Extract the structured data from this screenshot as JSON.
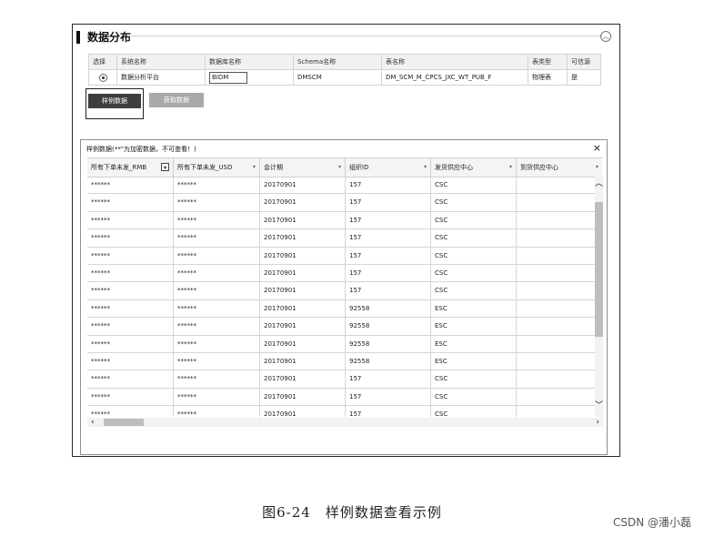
{
  "section": {
    "title": "数据分布"
  },
  "meta_table": {
    "headers": [
      "选择",
      "系统名称",
      "数据库名称",
      "Schema名称",
      "表名称",
      "表类型",
      "可信源"
    ],
    "row": {
      "system": "数据分析平台",
      "db_name": "BIDM",
      "schema": "DMSCM",
      "table": "DM_SCM_M_CPCS_JXC_WT_PUB_F",
      "table_type": "物理表",
      "trusted": "是"
    }
  },
  "buttons": {
    "sample": "样例数据",
    "fetch": "获取数据"
  },
  "dialog": {
    "title": "样例数据(**\"为加密数据，不可查看！)",
    "close": "×",
    "columns": [
      "所有下单未发_RMB",
      "所有下单未发_USD",
      "会计期",
      "组织ID",
      "发货供应中心",
      "到货供应中心"
    ],
    "rows": [
      [
        "******",
        "******",
        "20170901",
        "157",
        "CSC",
        ""
      ],
      [
        "******",
        "******",
        "20170901",
        "157",
        "CSC",
        ""
      ],
      [
        "******",
        "******",
        "20170901",
        "157",
        "CSC",
        ""
      ],
      [
        "******",
        "******",
        "20170901",
        "157",
        "CSC",
        ""
      ],
      [
        "******",
        "******",
        "20170901",
        "157",
        "CSC",
        ""
      ],
      [
        "******",
        "******",
        "20170901",
        "157",
        "CSC",
        ""
      ],
      [
        "******",
        "******",
        "20170901",
        "157",
        "CSC",
        ""
      ],
      [
        "******",
        "******",
        "20170901",
        "92558",
        "ESC",
        ""
      ],
      [
        "******",
        "******",
        "20170901",
        "92558",
        "ESC",
        ""
      ],
      [
        "******",
        "******",
        "20170901",
        "92558",
        "ESC",
        ""
      ],
      [
        "******",
        "******",
        "20170901",
        "92558",
        "ESC",
        ""
      ],
      [
        "******",
        "******",
        "20170901",
        "157",
        "CSC",
        ""
      ],
      [
        "******",
        "******",
        "20170901",
        "157",
        "CSC",
        ""
      ],
      [
        "******",
        "******",
        "20170901",
        "157",
        "CSC",
        ""
      ]
    ]
  },
  "caption": "图6-24　样例数据查看示例",
  "watermark": "CSDN @潘小磊"
}
